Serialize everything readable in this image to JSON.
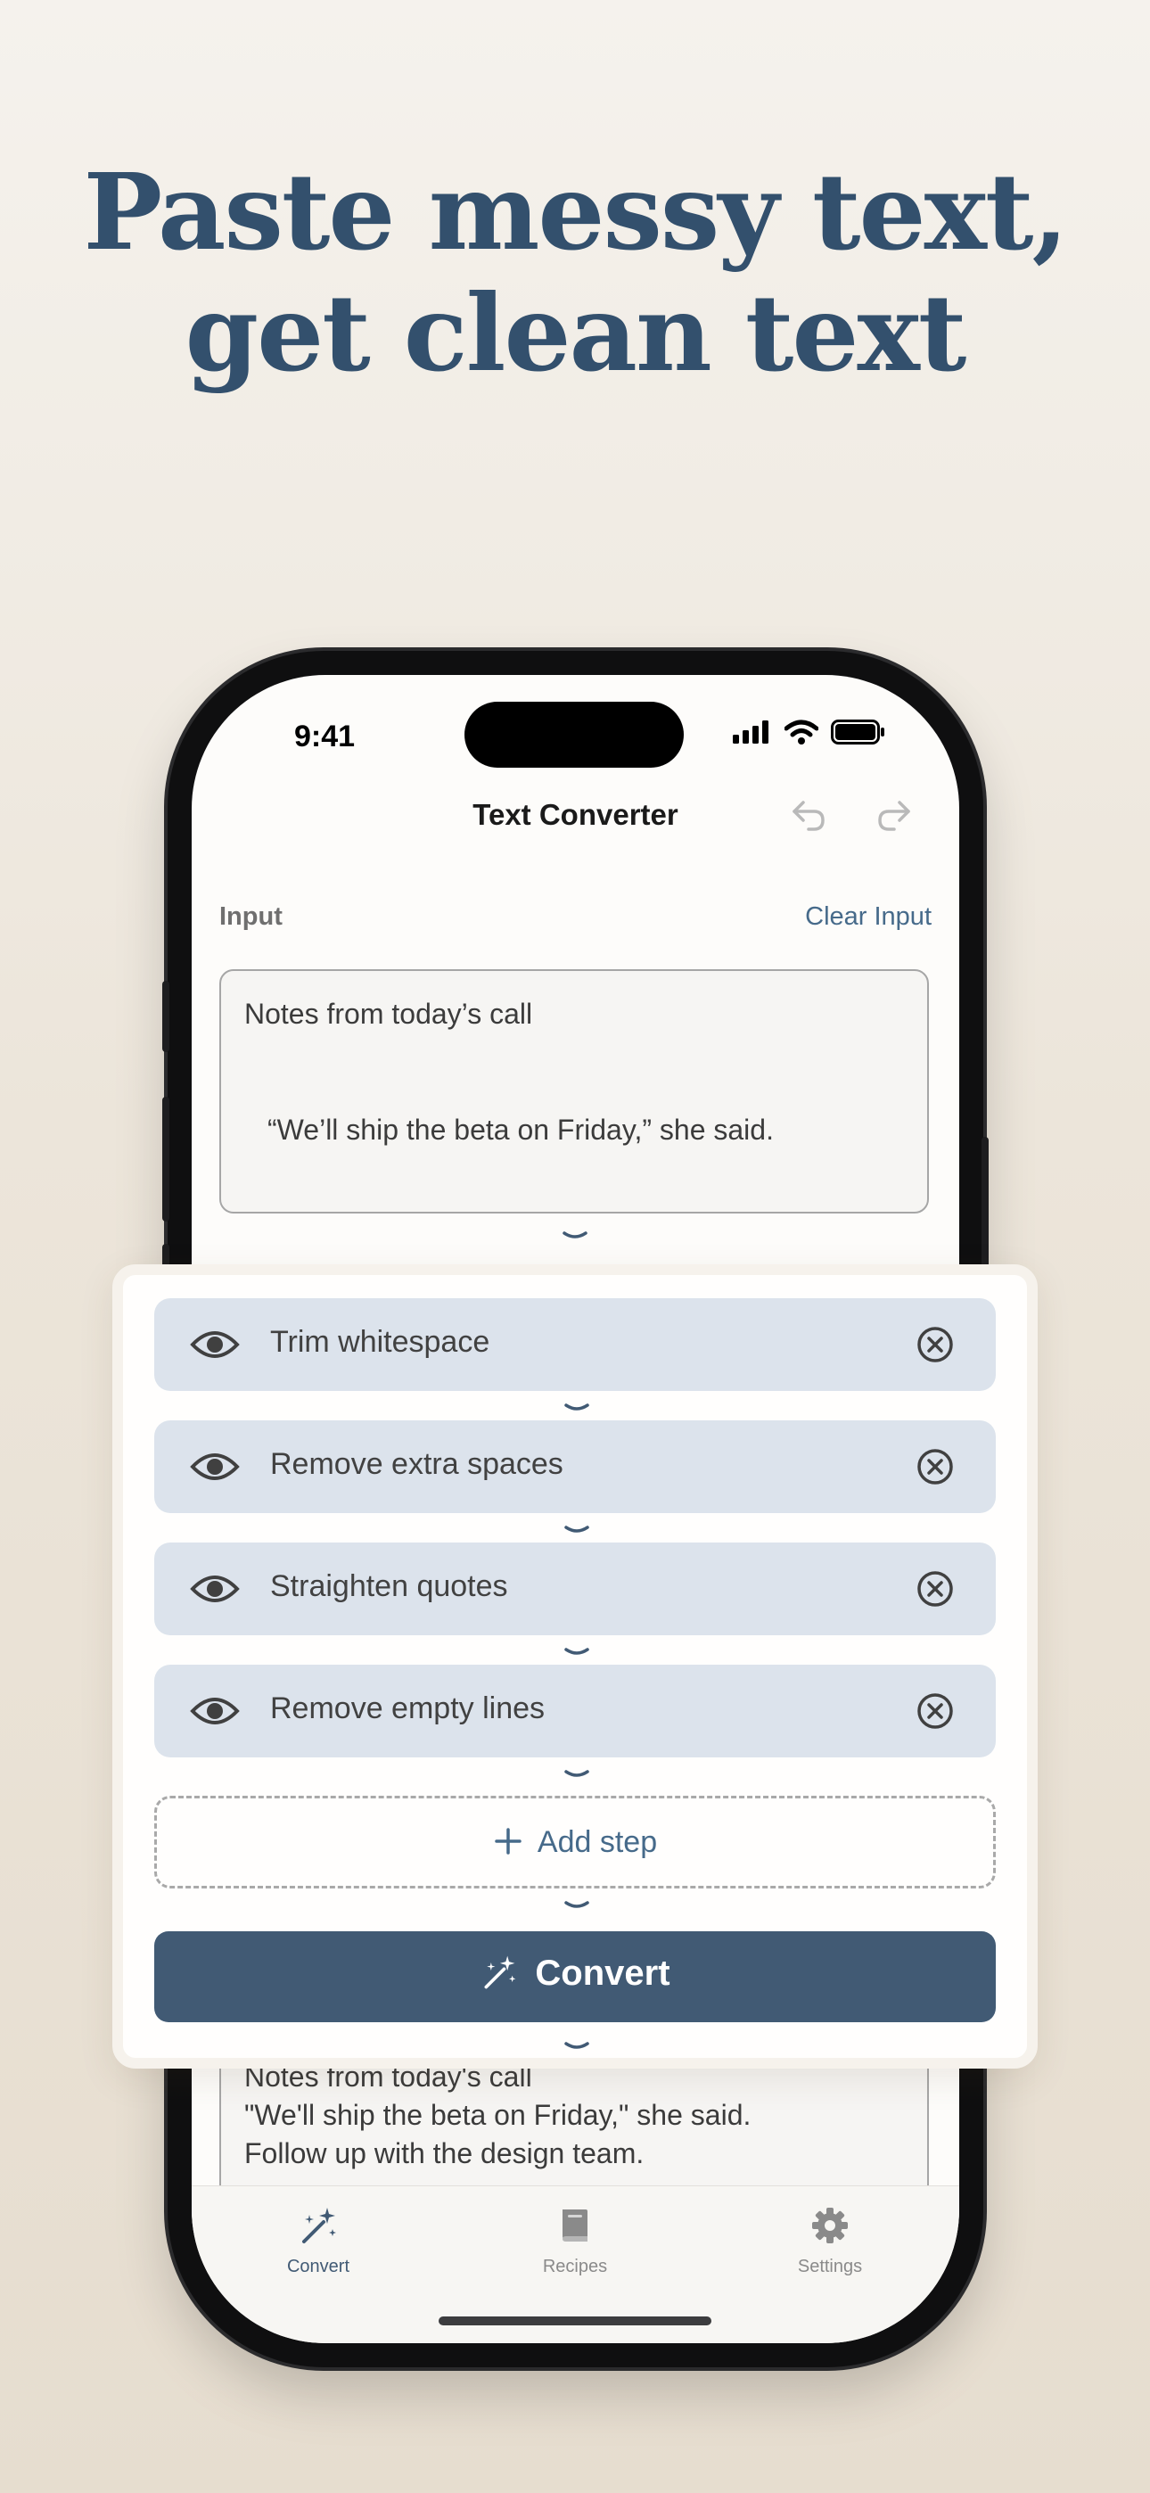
{
  "headline": {
    "line1": "Paste messy text,",
    "line2": "get clean text"
  },
  "status_bar": {
    "time": "9:41"
  },
  "nav": {
    "title": "Text Converter"
  },
  "input_section": {
    "label": "Input",
    "clear_label": "Clear Input",
    "text_line1": "Notes from today’s call",
    "text_line2": "“We’ll ship the beta on Friday,” she said."
  },
  "steps": [
    {
      "label": "Trim whitespace"
    },
    {
      "label": "Remove extra spaces"
    },
    {
      "label": "Straighten quotes"
    },
    {
      "label": "Remove empty lines"
    }
  ],
  "add_step": {
    "label": "Add step"
  },
  "convert": {
    "label": "Convert"
  },
  "output": {
    "line1": "Notes from today's call",
    "line2": "\"We'll ship the beta on Friday,\" she said.",
    "line3": "Follow up with the design team."
  },
  "tabs": [
    {
      "label": "Convert",
      "icon": "magic-wand-icon",
      "active": true
    },
    {
      "label": "Recipes",
      "icon": "book-icon",
      "active": false
    },
    {
      "label": "Settings",
      "icon": "gear-icon",
      "active": false
    }
  ],
  "colors": {
    "headline": "#33506d",
    "accent": "#466a8a",
    "convert_button": "#415a74",
    "step_background": "#dce3ec"
  }
}
